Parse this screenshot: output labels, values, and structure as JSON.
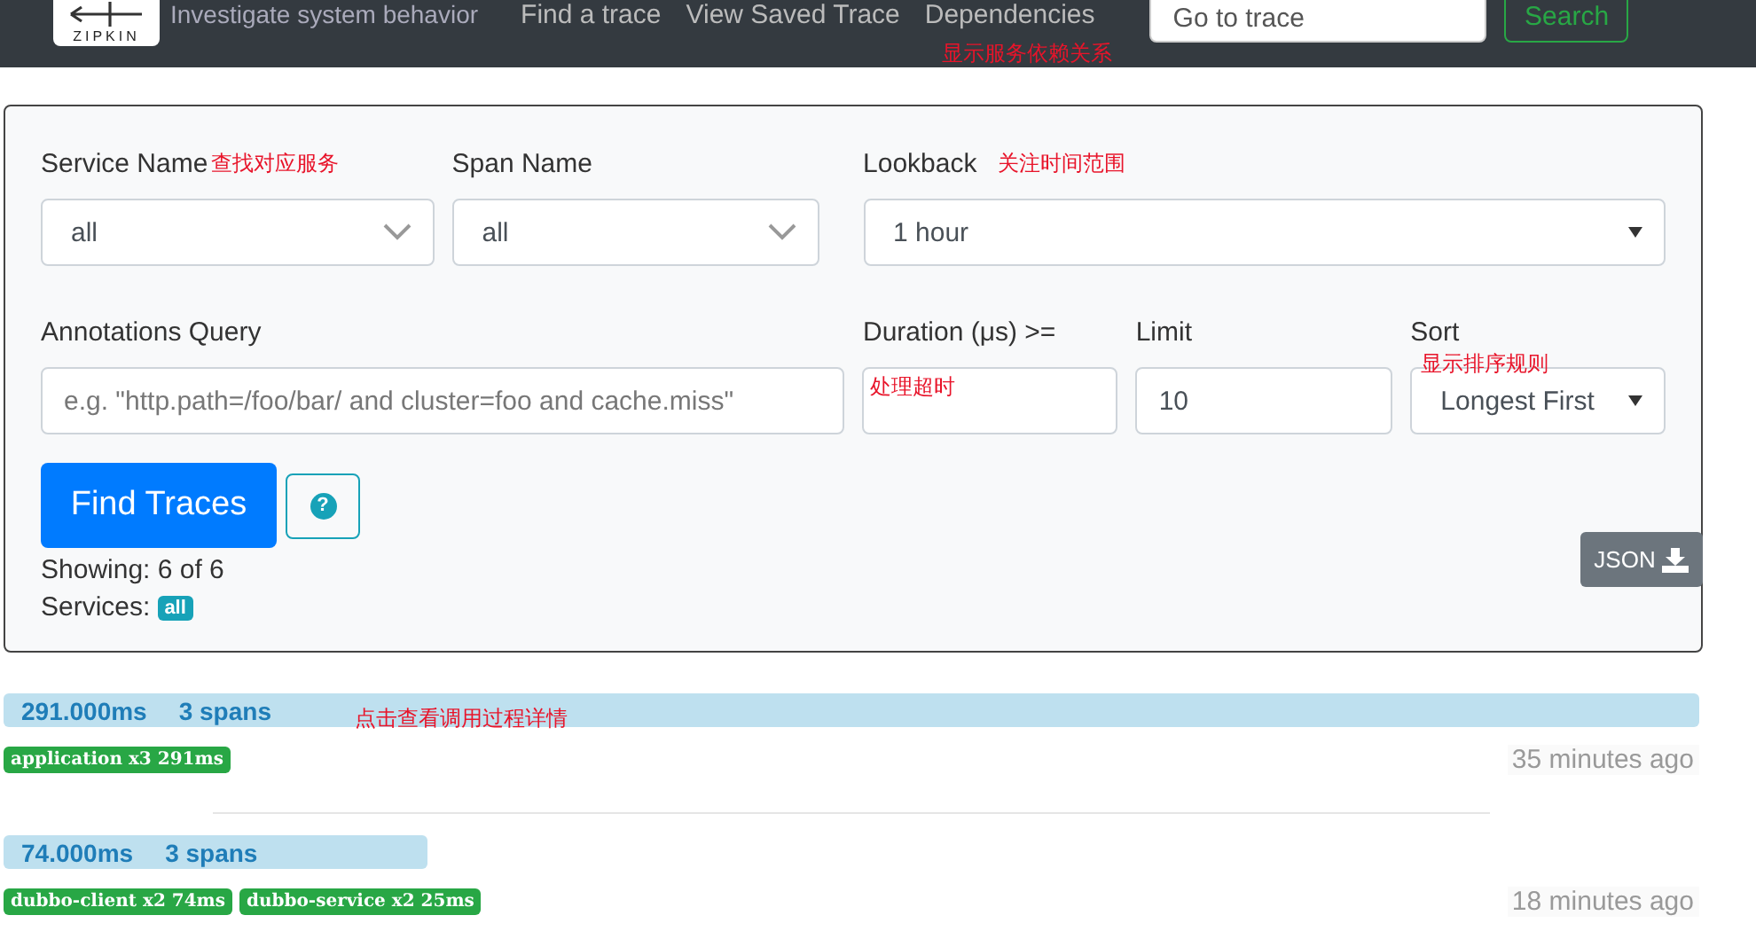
{
  "navbar": {
    "logo": "ZIPKIN",
    "tagline": "Investigate system behavior",
    "links": [
      {
        "label": "Find a trace",
        "selected": false
      },
      {
        "label": "View Saved Trace",
        "selected": false
      },
      {
        "label": "Dependencies",
        "selected": false
      }
    ],
    "goto": {
      "placeholder": "Go to trace"
    },
    "search_button": "Search",
    "note": "显示服务依赖关系"
  },
  "form": {
    "service": {
      "label": "Service Name",
      "note": "查找对应服务",
      "value": "all"
    },
    "span": {
      "label": "Span Name",
      "value": "all"
    },
    "lookback": {
      "label": "Lookback",
      "note": "关注时间范围",
      "value": "1 hour"
    },
    "annotations": {
      "label": "Annotations Query",
      "placeholder": "e.g. \"http.path=/foo/bar/ and cluster=foo and cache.miss\""
    },
    "duration": {
      "label": "Duration (μs) >=",
      "note": "处理超时"
    },
    "limit": {
      "label": "Limit",
      "value": "10"
    },
    "sort": {
      "label": "Sort",
      "note": "显示排序规则",
      "value": "Longest First"
    },
    "find_button": "Find Traces",
    "help_button": "?",
    "showing": "Showing: 6 of 6",
    "services_label": "Services:",
    "services_badge": "all",
    "json_button": "JSON"
  },
  "traces": [
    {
      "duration": "291.000ms",
      "spans": "3 spans",
      "level": 1.0,
      "note": "点击查看调用过程详情",
      "badges": [
        "application x3 291ms"
      ],
      "time": "35 minutes ago"
    },
    {
      "duration": "74.000ms",
      "spans": "3 spans",
      "level": 0.25,
      "badges": [
        "dubbo-client x2 74ms",
        "dubbo-service x2 25ms"
      ],
      "time": "18 minutes ago"
    }
  ]
}
